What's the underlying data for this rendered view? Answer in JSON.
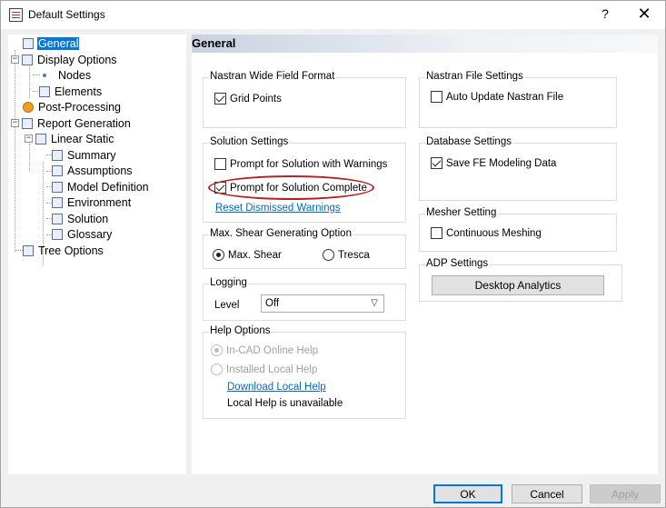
{
  "window": {
    "title": "Default Settings",
    "help_glyph": "?",
    "close_glyph": "✕"
  },
  "tree": {
    "items": [
      {
        "label": "General"
      },
      {
        "label": "Display Options"
      },
      {
        "label": "Nodes"
      },
      {
        "label": "Elements"
      },
      {
        "label": "Post-Processing"
      },
      {
        "label": "Report Generation"
      },
      {
        "label": "Linear Static"
      },
      {
        "label": "Summary"
      },
      {
        "label": "Assumptions"
      },
      {
        "label": "Model Definition"
      },
      {
        "label": "Environment"
      },
      {
        "label": "Solution"
      },
      {
        "label": "Glossary"
      },
      {
        "label": "Tree Options"
      }
    ],
    "expander_glyph": "−"
  },
  "panel": {
    "title": "General",
    "nastran_wide": {
      "title": "Nastran Wide Field Format",
      "grid_points": "Grid Points"
    },
    "nastran_file": {
      "title": "Nastran File Settings",
      "auto_update": "Auto Update Nastran File"
    },
    "solution": {
      "title": "Solution Settings",
      "prompt_warnings": "Prompt for Solution with Warnings",
      "prompt_complete": "Prompt for Solution Complete",
      "reset_link": "Reset Dismissed Warnings"
    },
    "database": {
      "title": "Database Settings",
      "save_fe": "Save FE Modeling Data"
    },
    "mesher": {
      "title": "Mesher Setting",
      "continuous": "Continuous Meshing"
    },
    "adp": {
      "title": "ADP Settings",
      "desktop_analytics": "Desktop Analytics"
    },
    "shear": {
      "title": "Max. Shear Generating Option",
      "max_shear": "Max. Shear",
      "tresca": "Tresca"
    },
    "logging": {
      "title": "Logging",
      "level_label": "Level",
      "level_value": "Off"
    },
    "help": {
      "title": "Help Options",
      "online": "In-CAD Online Help",
      "local": "Installed Local Help",
      "download_link": "Download Local Help",
      "unavailable": "Local Help is unavailable"
    }
  },
  "footer": {
    "ok": "OK",
    "cancel": "Cancel",
    "apply": "Apply"
  },
  "colors": {
    "selection": "#0078d7",
    "highlight_ring": "#b22222",
    "link": "#0066cc"
  }
}
